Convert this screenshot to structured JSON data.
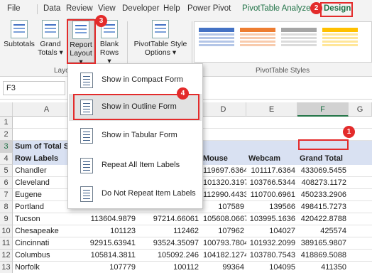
{
  "tabs": [
    "File",
    "Data",
    "Review",
    "View",
    "Developer",
    "Help",
    "Power Pivot",
    "PivotTable Analyze",
    "Design"
  ],
  "ribbon": {
    "subtotals": "Subtotals",
    "grand_totals": [
      "Grand",
      "Totals"
    ],
    "report_layout": [
      "Report",
      "Layout"
    ],
    "blank_rows": [
      "Blank",
      "Rows"
    ],
    "style_options": [
      "PivotTable Style",
      "Options"
    ],
    "group_layout": "Layo",
    "group_styles": "PivotTable Styles"
  },
  "name_box": "F3",
  "menu": [
    "Show in Compact Form",
    "Show in Outline Form",
    "Show in Tabular Form",
    "Repeat All Item Labels",
    "Do Not Repeat Item Labels"
  ],
  "columns": [
    "A",
    "D",
    "E",
    "F",
    "G"
  ],
  "row_numbers": [
    "1",
    "2",
    "3",
    "4",
    "5",
    "6",
    "7",
    "8",
    "9",
    "10",
    "11",
    "12",
    "13"
  ],
  "header_row3": "Sum of Total Sa",
  "header_row4": [
    "Row Labels",
    "Mouse",
    "Webcam",
    "Grand Total"
  ],
  "rows": [
    {
      "label": "Chandler",
      "d": "119697.6364",
      "e": "101117.6364",
      "f": "433069.5455"
    },
    {
      "label": "Cleveland",
      "d": "101320.3197",
      "e": "103766.5344",
      "f": "408273.1172"
    },
    {
      "label": "Eugene",
      "d": "112990.4433",
      "e": "110700.6961",
      "f": "450233.2906"
    },
    {
      "label": "Portland",
      "d": "107589",
      "e": "139566",
      "f": "498415.7273"
    },
    {
      "label": "Tucson",
      "b": "113604.9879",
      "c": "97214.66061",
      "d": "105608.0667",
      "e": "103995.1636",
      "f": "420422.8788"
    },
    {
      "label": "Chesapeake",
      "b": "101123",
      "c": "112462",
      "d": "107962",
      "e": "104027",
      "f": "425574"
    },
    {
      "label": "Cincinnati",
      "b": "92915.63941",
      "c": "93524.35097",
      "d": "100793.7804",
      "e": "101932.2099",
      "f": "389165.9807"
    },
    {
      "label": "Columbus",
      "b": "105814.3811",
      "c": "105092.246",
      "d": "104182.1274",
      "e": "103780.7543",
      "f": "418869.5088"
    },
    {
      "label": "Norfolk",
      "b": "107779",
      "c": "100112",
      "d": "99364",
      "e": "104095",
      "f": "411350"
    }
  ],
  "badges": [
    "1",
    "2",
    "3",
    "4"
  ]
}
